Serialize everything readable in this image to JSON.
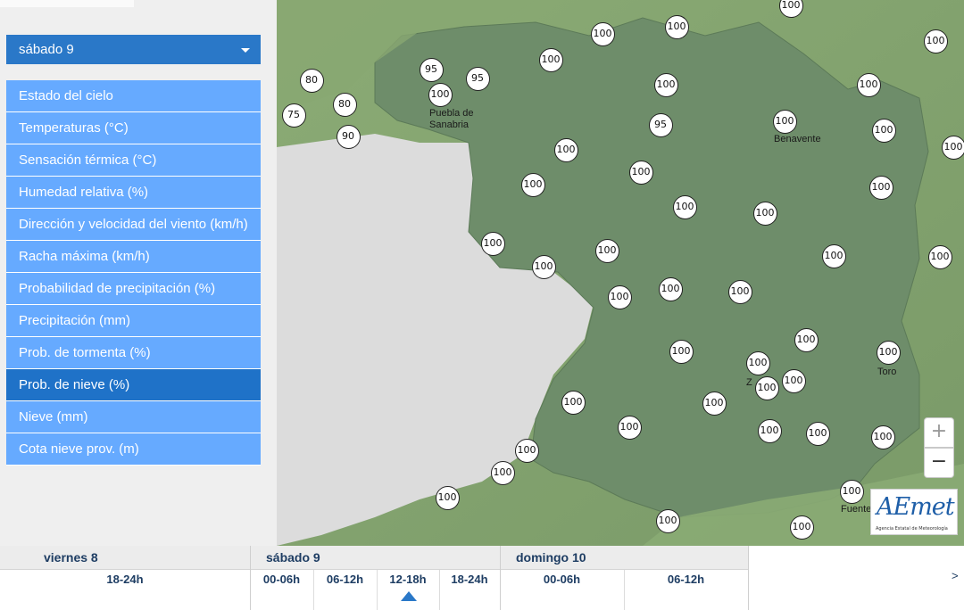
{
  "sidebar": {
    "day_selector": {
      "selected": "sábado 9"
    },
    "menu": [
      {
        "label": "Estado del cielo",
        "active": false
      },
      {
        "label": "Temperaturas (°C)",
        "active": false
      },
      {
        "label": "Sensación térmica (°C)",
        "active": false
      },
      {
        "label": "Humedad relativa (%)",
        "active": false
      },
      {
        "label": "Dirección y velocidad del viento (km/h)",
        "active": false
      },
      {
        "label": "Racha máxima (km/h)",
        "active": false
      },
      {
        "label": "Probabilidad de precipitación (%)",
        "active": false
      },
      {
        "label": "Precipitación (mm)",
        "active": false
      },
      {
        "label": "Prob. de tormenta (%)",
        "active": false
      },
      {
        "label": "Prob. de nieve (%)",
        "active": true
      },
      {
        "label": "Nieve (mm)",
        "active": false
      },
      {
        "label": "Cota nieve prov. (m)",
        "active": false
      }
    ]
  },
  "map": {
    "places": [
      "Puebla de Sanabria",
      "Benavente",
      "Toro",
      "Z",
      "Fuente"
    ],
    "marker_values": [
      "100",
      "100",
      "100",
      "100",
      "100",
      "80",
      "95",
      "95",
      "100",
      "100",
      "100",
      "75",
      "80",
      "95",
      "100",
      "100",
      "90",
      "100",
      "100",
      "100",
      "100",
      "100",
      "100",
      "100",
      "100",
      "100",
      "100",
      "100",
      "100",
      "100",
      "100",
      "100",
      "100",
      "100",
      "100",
      "100",
      "100",
      "100",
      "100",
      "100",
      "100",
      "100",
      "100",
      "100",
      "100",
      "100",
      "100",
      "100",
      "100",
      "100",
      "100",
      "100",
      "100",
      "100",
      "100"
    ],
    "zoom_in_label": "+",
    "zoom_out_label": "−",
    "logo_text": "AEmet",
    "logo_subtitle": "Agencia Estatal de Meteorología",
    "colors": {
      "region": "#6e8d6a",
      "terrain": "#83a56f",
      "outside": "#dcdcdc",
      "active_tab": "#1f72c8",
      "menu": "#66aaff"
    }
  },
  "timeline": {
    "days": [
      "viernes 8",
      "sábado 9",
      "domingo 10"
    ],
    "slots": [
      "18-24h",
      "00-06h",
      "06-12h",
      "12-18h",
      "18-24h",
      "00-06h",
      "06-12h"
    ],
    "selected_slot": "12-18h",
    "next_label": ">"
  }
}
